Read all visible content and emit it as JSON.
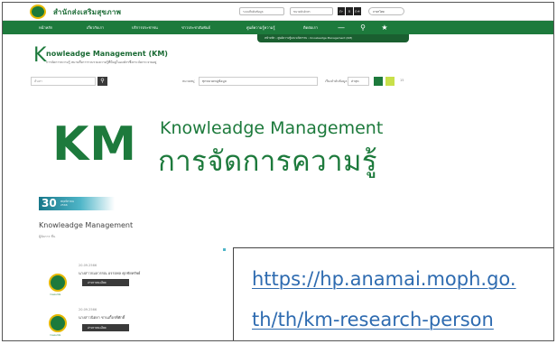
{
  "header": {
    "site_name": "สำนักส่งเสริมสุขภาพ",
    "site_search_placeholder": "ระบบสืบค้นข้อมูล",
    "font_minus": "ก-",
    "font_normal": "ก",
    "font_plus": "ก+",
    "font_size_label": "ขนาดตัวอักษร",
    "contrast_light": "ก",
    "contrast_dark": "ก",
    "language": "ภาษาไทย"
  },
  "nav": {
    "items": [
      "หน้าหลัก",
      "เกี่ยวกับเรา",
      "บริการประชาชน",
      "ข่าวประชาสัมพันธ์",
      "ศูนย์ความรู้ความรู้",
      "ติดต่อเรา"
    ],
    "icons": [
      "menu-icon",
      "search-icon",
      "sitemap-icon"
    ]
  },
  "breadcrumb": [
    "หน้าหลัก",
    "ศูนย์ความรู้และนวัตกรรม",
    "Knowleadge Management (KM)"
  ],
  "page": {
    "big_letter": "K",
    "title": "nowleadge Management (KM)",
    "subtitle": "การจัดการความรู้ หมายถึงการรวบรวมความรู้ที่มีอยู่ในองค์กรซึ่งกระจัดกระจายอยู่"
  },
  "filter": {
    "search_placeholder": "ค้นหา",
    "category_label": "หมวดหมู่",
    "category_value": "ทุกหมวดหมู่ข้อมูล",
    "sort_label": "เรียงลำดับข้อมูล",
    "sort_value": "ล่าสุด",
    "view_label": "15"
  },
  "banner": {
    "km": "KM",
    "english": "Knowleadge Management",
    "thai": "การจัดการความรู้"
  },
  "date_badge": {
    "day": "30",
    "month": "พฤศจิกายน 2566"
  },
  "section": {
    "title": "Knowleadge Management",
    "subtitle": "ผู้จัดการ ชื่น"
  },
  "list_items": [
    {
      "logo_caption": "กรมอนามัย",
      "date": "20.09.2566",
      "name": "นางสาวกมลวรรณ อรรถพล ศุภชัยทรัพย์",
      "button": "อ่านรายละเอียด"
    },
    {
      "logo_caption": "กรมอนามัย",
      "date": "20.09.2566",
      "name": "นางสาวนิตยา ชานเกื้อรพีศักดิ์",
      "button": "อ่านรายละเอียด"
    }
  ],
  "url_callout": {
    "line1": "https://hp.anamai.moph.go.",
    "line2": "th/th/km-research-person"
  },
  "colors": {
    "brand_green": "#1d7a3c",
    "accent_teal": "#4fb5c8",
    "link_blue": "#2e6bb0"
  }
}
